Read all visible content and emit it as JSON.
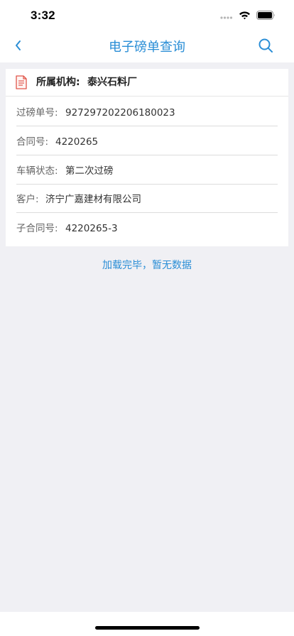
{
  "status_bar": {
    "time": "3:32",
    "icons": [
      "signal-dots-icon",
      "wifi-icon",
      "battery-icon"
    ]
  },
  "nav": {
    "back_icon": "chevron-left-icon",
    "title": "电子磅单查询",
    "search_icon": "search-icon"
  },
  "colors": {
    "accent": "#2a8ed6",
    "background": "#f0f0f4",
    "card": "#ffffff",
    "doc_icon": "#e0554a"
  },
  "card": {
    "icon": "document-icon",
    "org_label": "所属机构:",
    "org_value": "泰兴石料厂",
    "rows": [
      {
        "label": "过磅单号:",
        "value": "927297202206180023"
      },
      {
        "label": "合同号:",
        "value": "4220265"
      },
      {
        "label": "车辆状态:",
        "value": "第二次过磅"
      },
      {
        "label": "客户:",
        "value": "济宁广嘉建材有限公司"
      },
      {
        "label": "子合同号:",
        "value": "4220265-3"
      }
    ]
  },
  "footer_tip": "加载完毕，暂无数据"
}
